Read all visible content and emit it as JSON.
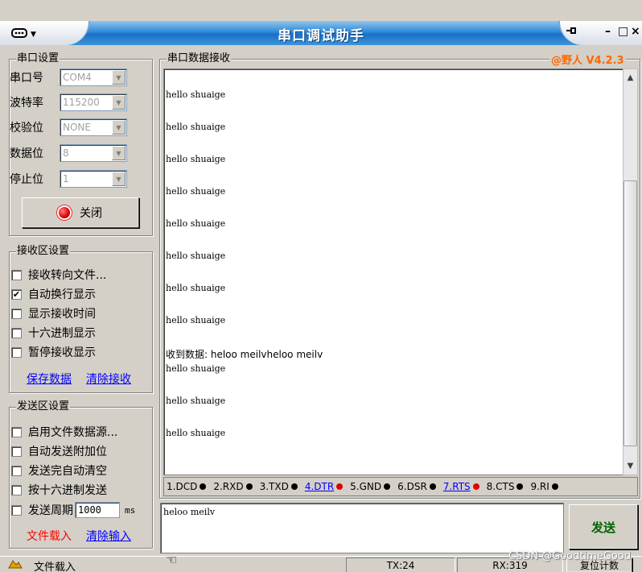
{
  "window": {
    "title": "串口调试助手",
    "system_menu_icon": "serial-port-icon"
  },
  "port_settings": {
    "title": "串口设置",
    "rows": [
      {
        "label": "串口号",
        "value": "COM4"
      },
      {
        "label": "波特率",
        "value": "115200"
      },
      {
        "label": "校验位",
        "value": "NONE"
      },
      {
        "label": "数据位",
        "value": "8"
      },
      {
        "label": "停止位",
        "value": "1"
      }
    ],
    "open_close_label": "关闭"
  },
  "receive_settings": {
    "title": "接收区设置",
    "options": [
      {
        "label": "接收转向文件...",
        "checked": false
      },
      {
        "label": "自动换行显示",
        "checked": true
      },
      {
        "label": "显示接收时间",
        "checked": false
      },
      {
        "label": "十六进制显示",
        "checked": false
      },
      {
        "label": "暂停接收显示",
        "checked": false
      }
    ],
    "save_link": "保存数据",
    "clear_link": "清除接收"
  },
  "send_settings": {
    "title": "发送区设置",
    "options": [
      {
        "label": "启用文件数据源...",
        "checked": false
      },
      {
        "label": "自动发送附加位",
        "checked": false
      },
      {
        "label": "发送完自动清空",
        "checked": false
      },
      {
        "label": "按十六进制发送",
        "checked": false
      }
    ],
    "period_label": "发送周期",
    "period_value": "1000",
    "period_unit": "ms",
    "file_load_label": "文件载入",
    "clear_input_link": "清除输入"
  },
  "receive_area": {
    "title": "串口数据接收",
    "brand": "@野人 V4.2.3",
    "lines": [
      "hello shuaige",
      "hello shuaige",
      "hello shuaige",
      "hello shuaige",
      "hello shuaige",
      "hello shuaige",
      "hello shuaige",
      "hello shuaige",
      "收到数据: heloo meilvheloo meilv",
      "hello shuaige",
      "hello shuaige",
      "hello shuaige"
    ]
  },
  "signals": [
    {
      "label": "1.DCD",
      "dot": "#000000",
      "link": false
    },
    {
      "label": "2.RXD",
      "dot": "#000000",
      "link": false
    },
    {
      "label": "3.TXD",
      "dot": "#000000",
      "link": false
    },
    {
      "label": "4.DTR",
      "dot": "#e00000",
      "link": true
    },
    {
      "label": "5.GND",
      "dot": "#000000",
      "link": false
    },
    {
      "label": "6.DSR",
      "dot": "#000000",
      "link": false
    },
    {
      "label": "7.RTS",
      "dot": "#e00000",
      "link": true
    },
    {
      "label": "8.CTS",
      "dot": "#000000",
      "link": false
    },
    {
      "label": "9.RI",
      "dot": "#000000",
      "link": false
    }
  ],
  "send_area": {
    "text": "heloo meilv",
    "send_button": "发送"
  },
  "statusbar": {
    "file_load": "文件载入",
    "tx": "TX:24",
    "rx": "RX:319",
    "reset_count": "复位计数"
  },
  "watermark": "CSDN @GoodtimeGood",
  "colors": {
    "title_blue": "#1a6fc4",
    "brand_orange": "#ff6600",
    "link_blue": "#0000ff",
    "dot_red": "#e00000",
    "send_green": "#006400"
  }
}
